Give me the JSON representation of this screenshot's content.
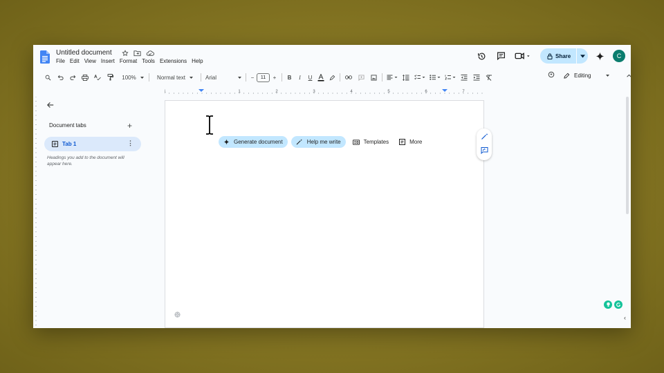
{
  "document": {
    "title": "Untitled document"
  },
  "menu": [
    "File",
    "Edit",
    "View",
    "Insert",
    "Format",
    "Tools",
    "Extensions",
    "Help"
  ],
  "header": {
    "share_label": "Share",
    "avatar_initial": "C"
  },
  "toolbar": {
    "zoom": "100%",
    "style": "Normal text",
    "font": "Arial",
    "font_size": "11",
    "mode": "Editing"
  },
  "ruler": {
    "labels": [
      "1",
      "1",
      "2",
      "3",
      "4",
      "5",
      "6",
      "7"
    ]
  },
  "sidebar": {
    "heading": "Document tabs",
    "tab_label": "Tab 1",
    "hint": "Headings you add to the document will appear here."
  },
  "chips": {
    "generate": "Generate document",
    "help": "Help me write",
    "templates": "Templates",
    "more": "More"
  },
  "colors": {
    "accent": "#0b57d0",
    "share_bg": "#c2e7ff",
    "tab_bg": "#dbe9fb",
    "avatar_bg": "#0b7d6e",
    "grammarly": "#15c39a"
  }
}
